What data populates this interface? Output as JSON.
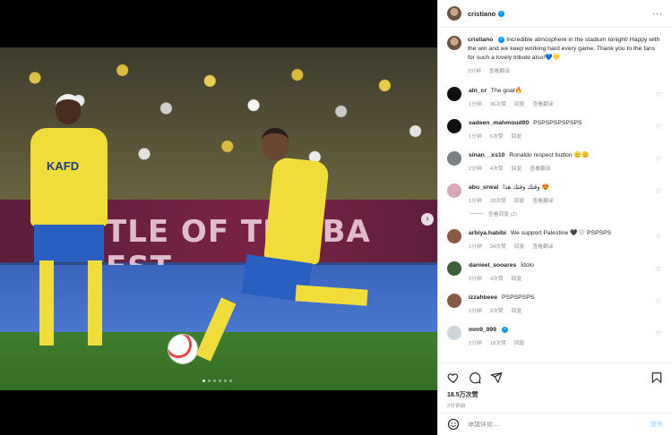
{
  "header": {
    "username": "cristiano",
    "more_label": "···"
  },
  "caption": {
    "username": "cristiano",
    "text": "Incredible atmosphere in the stadium tonight! Happy with the win and we keep working hard every game. Thank you to the fans for such a lovely tribute also!💙💛",
    "time": "3分钟",
    "translate": "查看翻译"
  },
  "photo": {
    "banner_text": "TLE OF THE BA  EST",
    "shirt_sponsor": "KAFD"
  },
  "comments": [
    {
      "username": "aln_cr",
      "text": "The goat🔥",
      "time": "1分钟",
      "likes": "36次赞",
      "reply": "回复",
      "translate": "查看翻译",
      "avatar": "dark"
    },
    {
      "username": "sadeen_mahmoud90",
      "text": "PSPSPSPSPSPS",
      "time": "1分钟",
      "likes": "6次赞",
      "reply": "回复",
      "translate": "",
      "avatar": "dark"
    },
    {
      "username": "sinan__xs10",
      "text": "Ronaldo respect button 🫡🫡",
      "time": "2分钟",
      "likes": "4次赞",
      "reply": "回复",
      "translate": "查看翻译",
      "avatar": "gray"
    },
    {
      "username": "abu_srwal",
      "text": "وقتك وقتك هذا 😍",
      "time": "1分钟",
      "likes": "33次赞",
      "reply": "回复",
      "translate": "查看翻译",
      "avatar": "pink",
      "view_replies": "查看回复 (2)"
    },
    {
      "username": "arbiya.habibi",
      "text": "We support Palestine 🖤🤍 PSPSPS",
      "time": "1分钟",
      "likes": "34次赞",
      "reply": "回复",
      "translate": "查看翻译",
      "avatar": "brown"
    },
    {
      "username": "danieel_sooares",
      "text": "Ídolo",
      "time": "2分钟",
      "likes": "4次赞",
      "reply": "回复",
      "translate": "",
      "avatar": "green"
    },
    {
      "username": "izzahbeee",
      "text": "PSPSPSPS",
      "time": "2分钟",
      "likes": "9次赞",
      "reply": "回复",
      "translate": "",
      "avatar": "brown"
    },
    {
      "username": "mm9_999",
      "text": "",
      "time": "2分钟",
      "likes": "18次赞",
      "reply": "回复",
      "translate": "",
      "avatar": "light",
      "verified": true
    }
  ],
  "actions": {
    "likes": "18.5万次赞",
    "date": "3分钟前"
  },
  "add_comment": {
    "placeholder": "添加评论...",
    "post_label": "发布"
  }
}
